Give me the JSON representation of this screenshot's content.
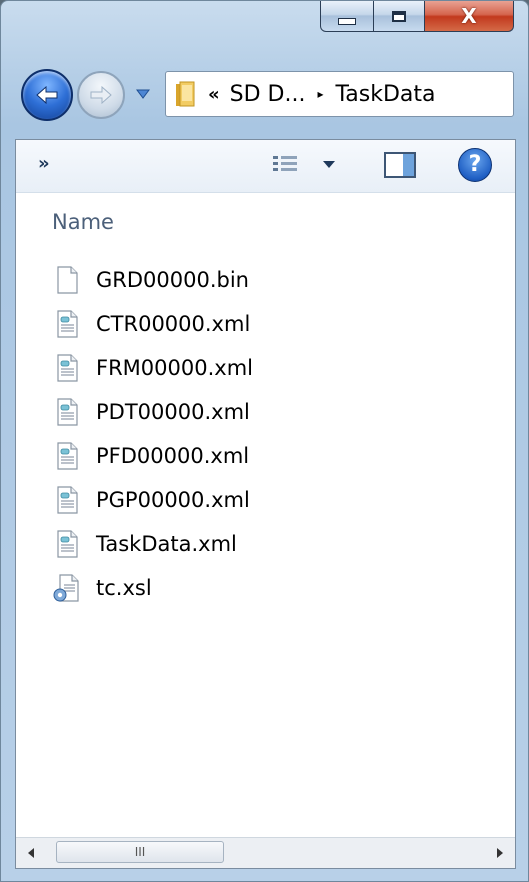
{
  "window": {
    "caption_buttons": {
      "minimize_icon": "minimize-icon",
      "maximize_icon": "maximize-icon",
      "close_glyph": "X"
    }
  },
  "navigation": {
    "back_icon": "back-arrow-icon",
    "forward_icon": "forward-arrow-icon",
    "history_icon": "chevron-down-icon",
    "breadcrumb": {
      "overflow": "«",
      "parent": "SD D...",
      "separator": "▸",
      "current": "TaskData"
    }
  },
  "toolbar": {
    "more_label": "»",
    "view_icon": "details-view-icon",
    "view_dropdown_icon": "chevron-down-icon",
    "preview_icon": "preview-pane-icon",
    "help_label": "?"
  },
  "list": {
    "column_header": "Name",
    "files": [
      {
        "name": "GRD00000.bin",
        "icon": "blank-file-icon"
      },
      {
        "name": "CTR00000.xml",
        "icon": "xml-file-icon"
      },
      {
        "name": "FRM00000.xml",
        "icon": "xml-file-icon"
      },
      {
        "name": "PDT00000.xml",
        "icon": "xml-file-icon"
      },
      {
        "name": "PFD00000.xml",
        "icon": "xml-file-icon"
      },
      {
        "name": "PGP00000.xml",
        "icon": "xml-file-icon"
      },
      {
        "name": "TaskData.xml",
        "icon": "xml-file-icon"
      },
      {
        "name": "tc.xsl",
        "icon": "xsl-file-icon"
      }
    ]
  },
  "scrollbar": {
    "thumb_grip": "III"
  },
  "colors": {
    "accent_blue": "#2e6fd6",
    "close_red": "#c2391e",
    "header_text": "#4c607a"
  }
}
